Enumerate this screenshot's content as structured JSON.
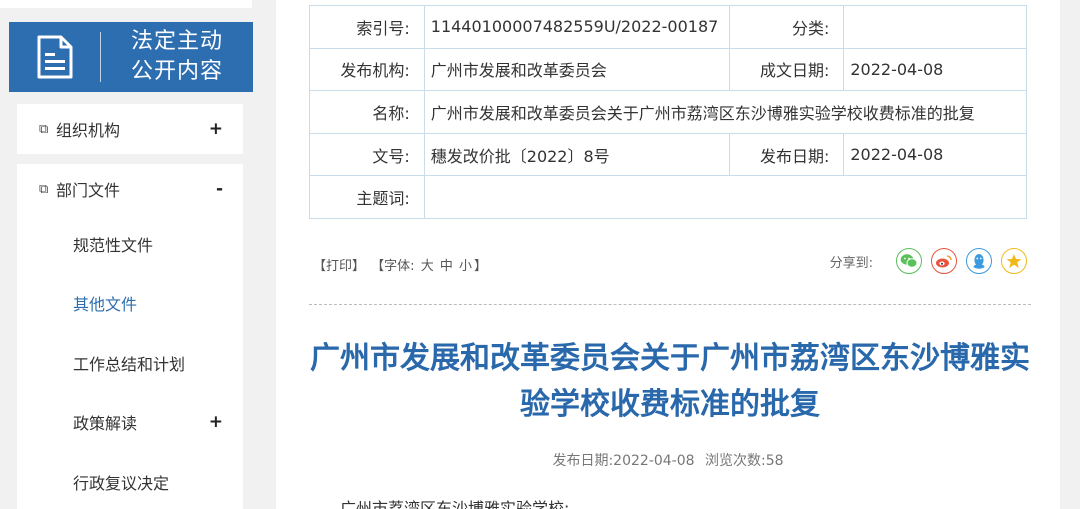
{
  "sidebar": {
    "header_line1": "法定主动",
    "header_line2": "公开内容",
    "org": {
      "label": "组织机构",
      "toggle": "+"
    },
    "dept": {
      "label": "部门文件",
      "toggle": "-"
    },
    "sub_items": [
      {
        "label": "规范性文件",
        "toggle": ""
      },
      {
        "label": "其他文件",
        "toggle": ""
      },
      {
        "label": "工作总结和计划",
        "toggle": ""
      },
      {
        "label": "政策解读",
        "toggle": "+"
      },
      {
        "label": "行政复议决定",
        "toggle": ""
      }
    ],
    "accent_color": "#2d6eb0"
  },
  "info": {
    "index_label": "索引号:",
    "index_value": "11440100007482559U/2022-00187",
    "category_label": "分类:",
    "category_value": "",
    "issuer_label": "发布机构:",
    "issuer_value": "广州市发展和改革委员会",
    "created_label": "成文日期:",
    "created_value": "2022-04-08",
    "name_label": "名称:",
    "name_value": "广州市发展和改革委员会关于广州市荔湾区东沙博雅实验学校收费标准的批复",
    "docno_label": "文号:",
    "docno_value": "穗发改价批〔2022〕8号",
    "published_label": "发布日期:",
    "published_value": "2022-04-08",
    "keywords_label": "主题词:",
    "keywords_value": ""
  },
  "tools": {
    "print": "【打印】",
    "font_prefix": "【字体:",
    "font_large": "大",
    "font_medium": "中",
    "font_small": "小",
    "font_suffix": "】",
    "share_label": "分享到:"
  },
  "share_icons": [
    "wechat-icon",
    "weibo-icon",
    "qq-icon",
    "qzone-icon"
  ],
  "article": {
    "title": "广州市发展和改革委员会关于广州市荔湾区东沙博雅实验学校收费标准的批复",
    "meta_date": "发布日期:2022-04-08",
    "meta_views": "浏览次数:58",
    "first_line": "广州市荔湾区东沙博雅实验学校:",
    "title_color": "#2a68ac"
  }
}
